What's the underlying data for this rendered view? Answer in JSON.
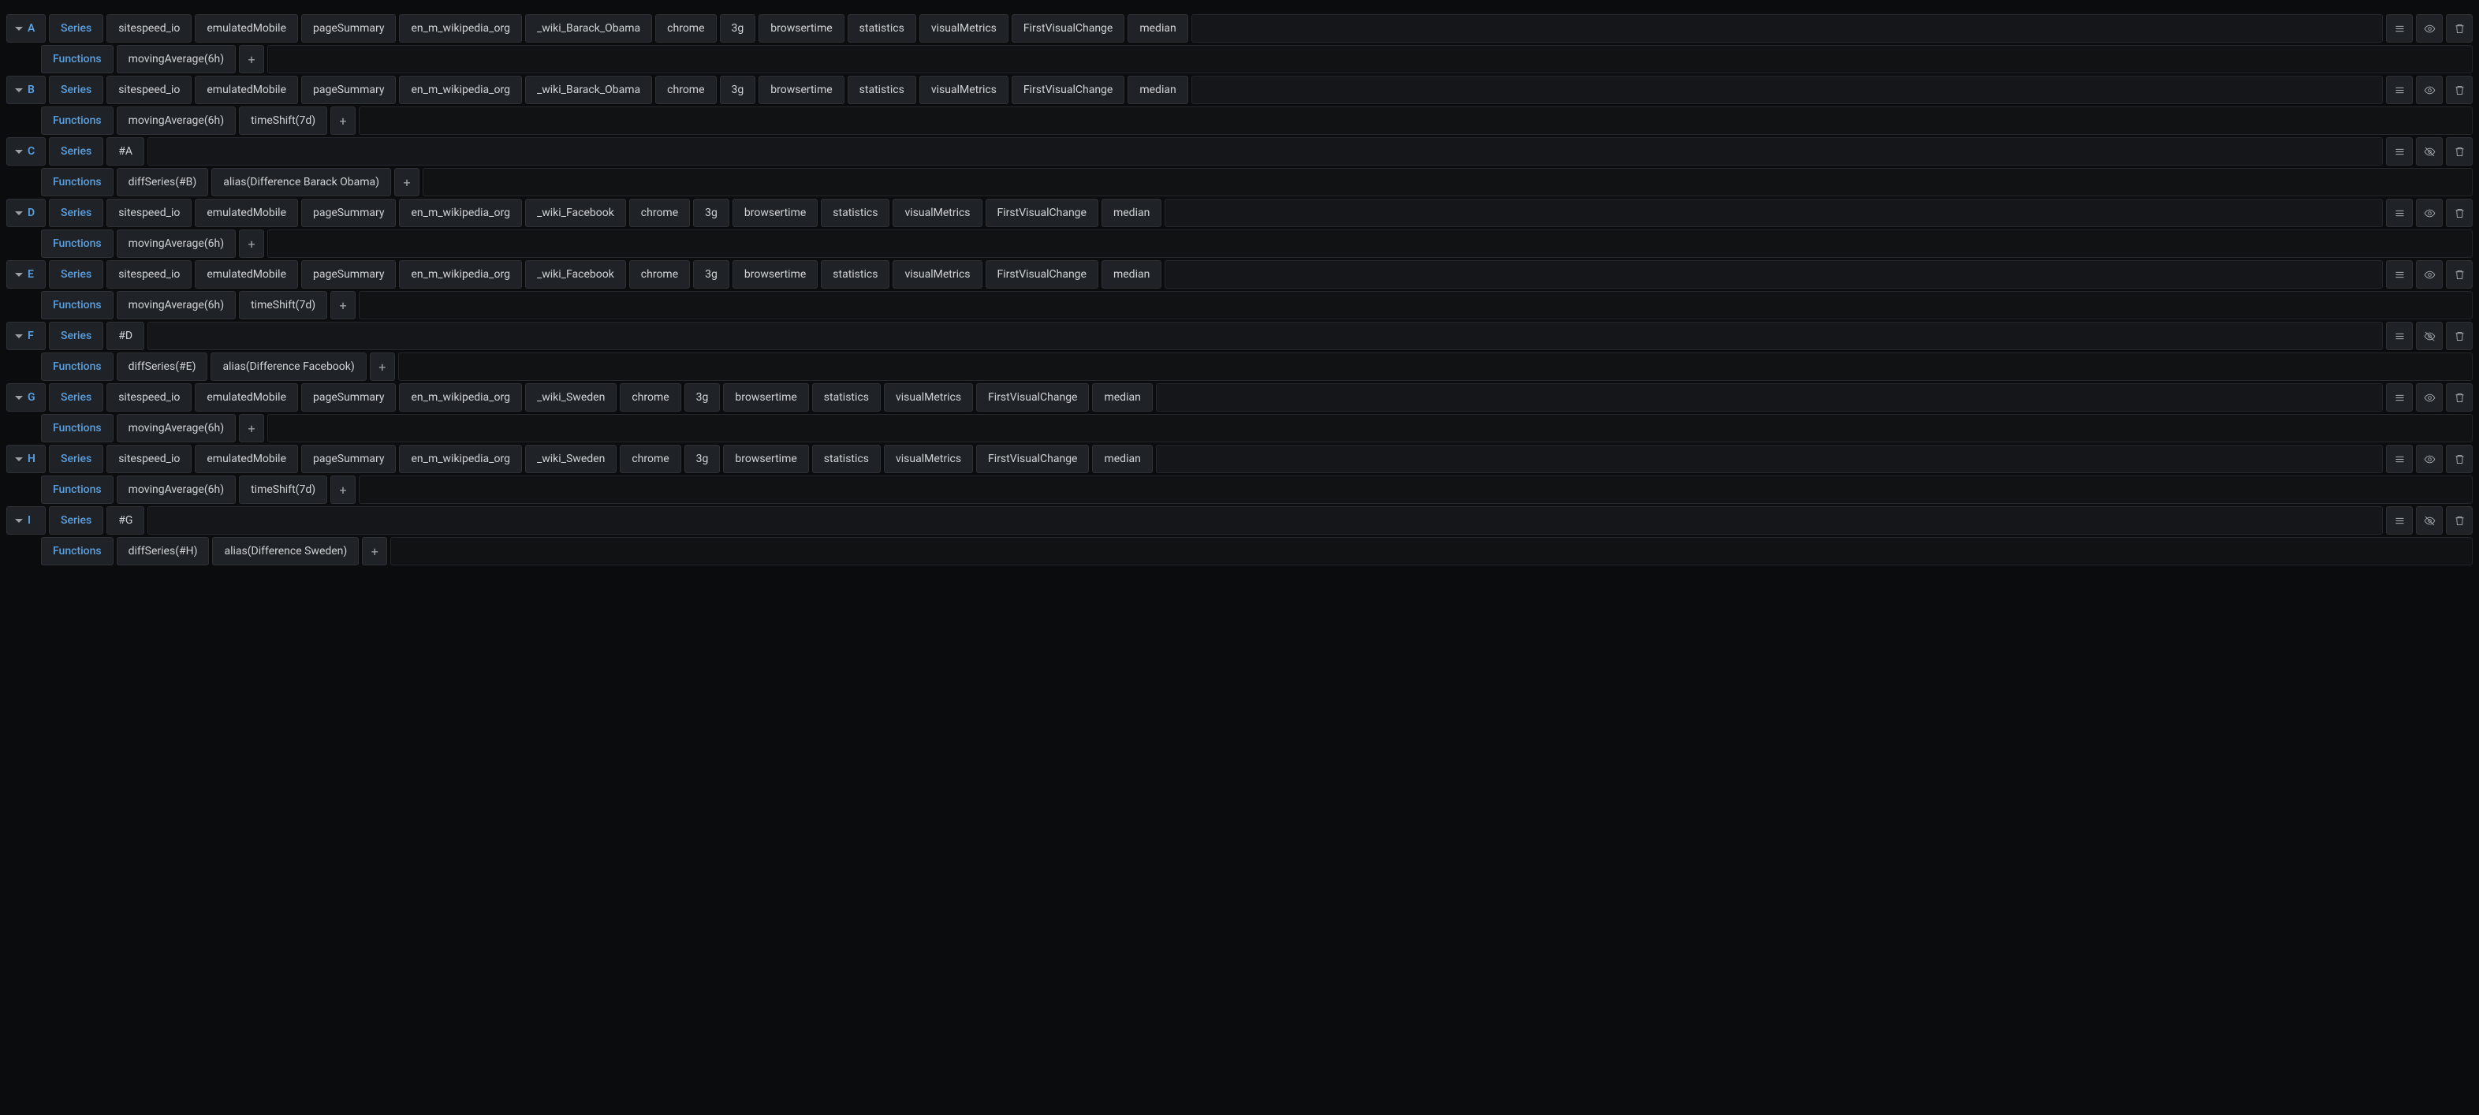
{
  "labels": {
    "series": "Series",
    "functions": "Functions",
    "plus": "+"
  },
  "queries": [
    {
      "id": "A",
      "series": [
        "sitespeed_io",
        "emulatedMobile",
        "pageSummary",
        "en_m_wikipedia_org",
        "_wiki_Barack_Obama",
        "chrome",
        "3g",
        "browsertime",
        "statistics",
        "visualMetrics",
        "FirstVisualChange",
        "median"
      ],
      "functions": [
        "movingAverage(6h)"
      ],
      "hidden": false
    },
    {
      "id": "B",
      "series": [
        "sitespeed_io",
        "emulatedMobile",
        "pageSummary",
        "en_m_wikipedia_org",
        "_wiki_Barack_Obama",
        "chrome",
        "3g",
        "browsertime",
        "statistics",
        "visualMetrics",
        "FirstVisualChange",
        "median"
      ],
      "functions": [
        "movingAverage(6h)",
        "timeShift(7d)"
      ],
      "hidden": false
    },
    {
      "id": "C",
      "ref": "#A",
      "functions": [
        "diffSeries(#B)",
        "alias(Difference Barack Obama)"
      ],
      "hidden": true
    },
    {
      "id": "D",
      "series": [
        "sitespeed_io",
        "emulatedMobile",
        "pageSummary",
        "en_m_wikipedia_org",
        "_wiki_Facebook",
        "chrome",
        "3g",
        "browsertime",
        "statistics",
        "visualMetrics",
        "FirstVisualChange",
        "median"
      ],
      "functions": [
        "movingAverage(6h)"
      ],
      "hidden": false
    },
    {
      "id": "E",
      "series": [
        "sitespeed_io",
        "emulatedMobile",
        "pageSummary",
        "en_m_wikipedia_org",
        "_wiki_Facebook",
        "chrome",
        "3g",
        "browsertime",
        "statistics",
        "visualMetrics",
        "FirstVisualChange",
        "median"
      ],
      "functions": [
        "movingAverage(6h)",
        "timeShift(7d)"
      ],
      "hidden": false
    },
    {
      "id": "F",
      "ref": "#D",
      "functions": [
        "diffSeries(#E)",
        "alias(Difference Facebook)"
      ],
      "hidden": true
    },
    {
      "id": "G",
      "series": [
        "sitespeed_io",
        "emulatedMobile",
        "pageSummary",
        "en_m_wikipedia_org",
        "_wiki_Sweden",
        "chrome",
        "3g",
        "browsertime",
        "statistics",
        "visualMetrics",
        "FirstVisualChange",
        "median"
      ],
      "functions": [
        "movingAverage(6h)"
      ],
      "hidden": false
    },
    {
      "id": "H",
      "series": [
        "sitespeed_io",
        "emulatedMobile",
        "pageSummary",
        "en_m_wikipedia_org",
        "_wiki_Sweden",
        "chrome",
        "3g",
        "browsertime",
        "statistics",
        "visualMetrics",
        "FirstVisualChange",
        "median"
      ],
      "functions": [
        "movingAverage(6h)",
        "timeShift(7d)"
      ],
      "hidden": false
    },
    {
      "id": "I",
      "ref": "#G",
      "functions": [
        "diffSeries(#H)",
        "alias(Difference Sweden)"
      ],
      "hidden": true
    }
  ]
}
